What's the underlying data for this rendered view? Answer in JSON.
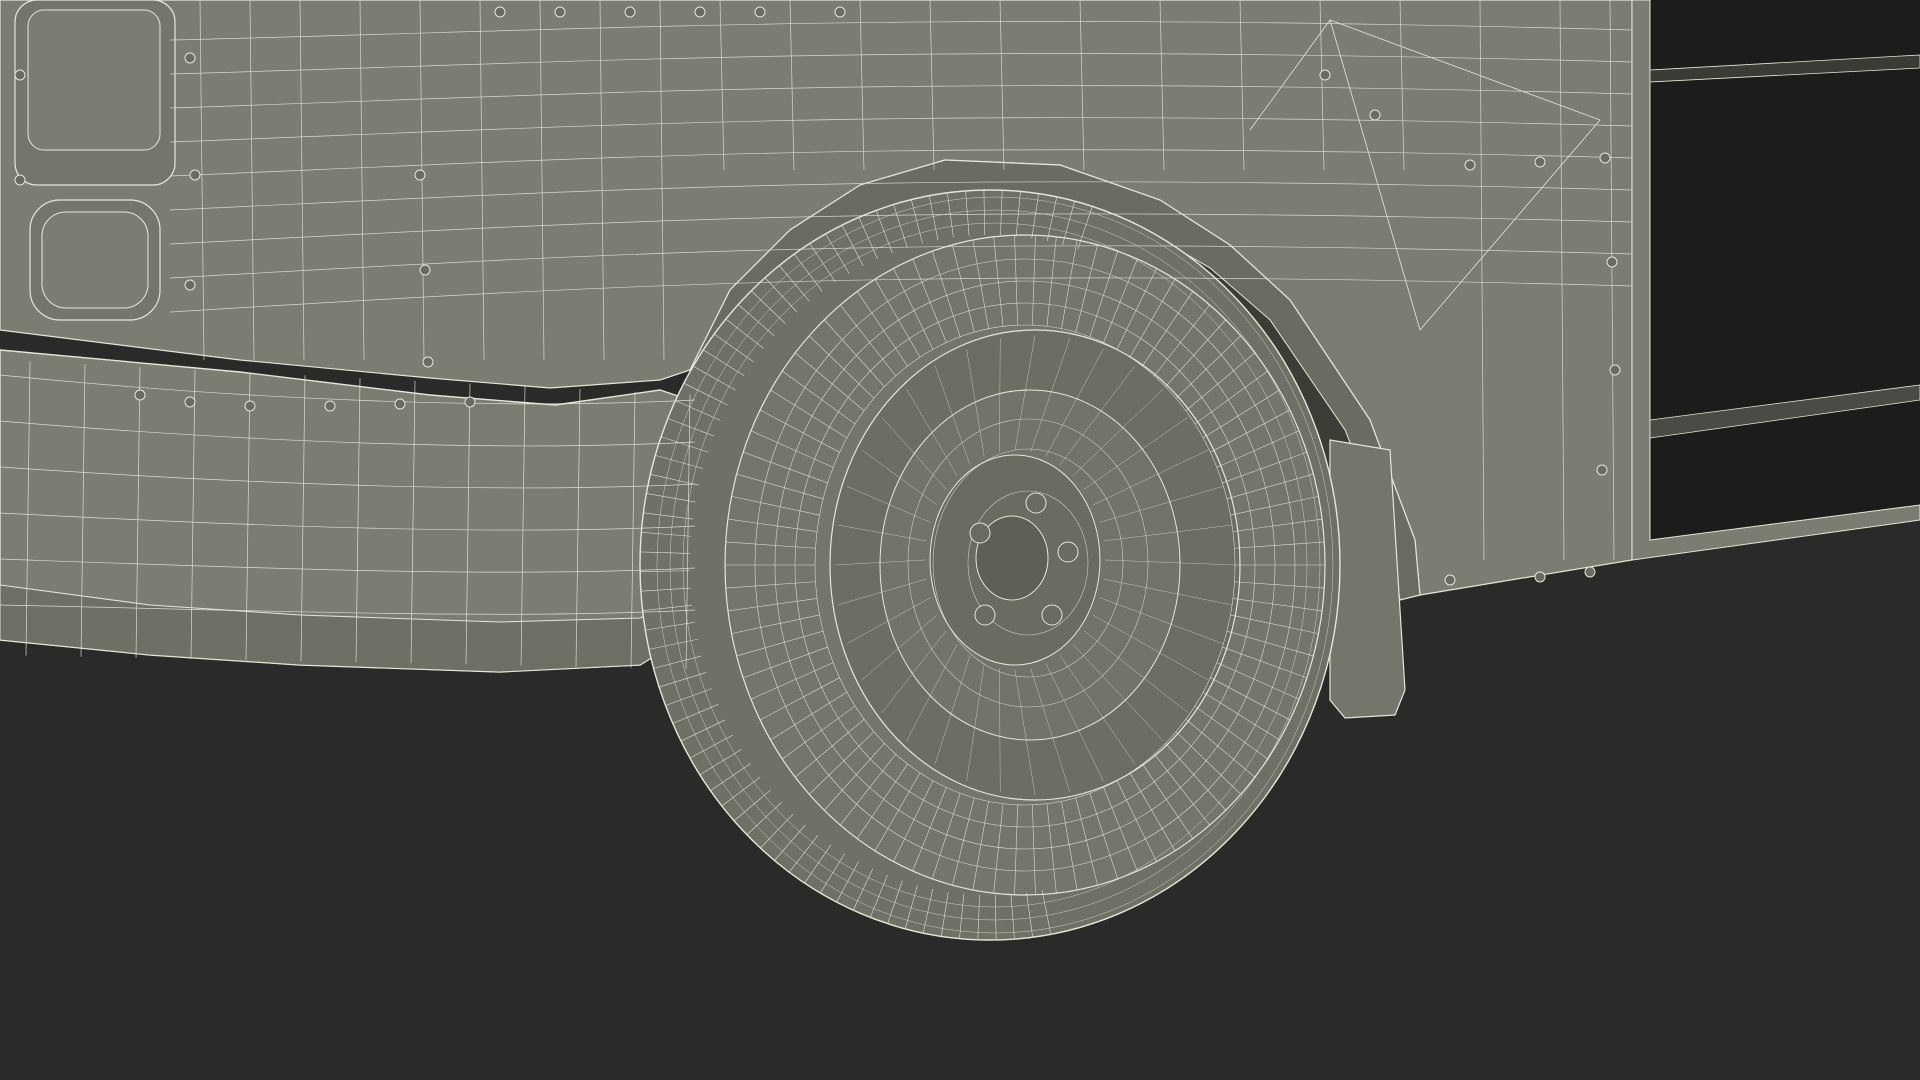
{
  "scene": {
    "background_color": "#2a2a28",
    "body_color": "#7c7d72",
    "body_light_color": "#8a8b80",
    "body_dark_color": "#5e5f56",
    "wire_color": "#e4e6d8",
    "tire_color": "#6f7066",
    "interior_color": "#1c1d1b"
  }
}
